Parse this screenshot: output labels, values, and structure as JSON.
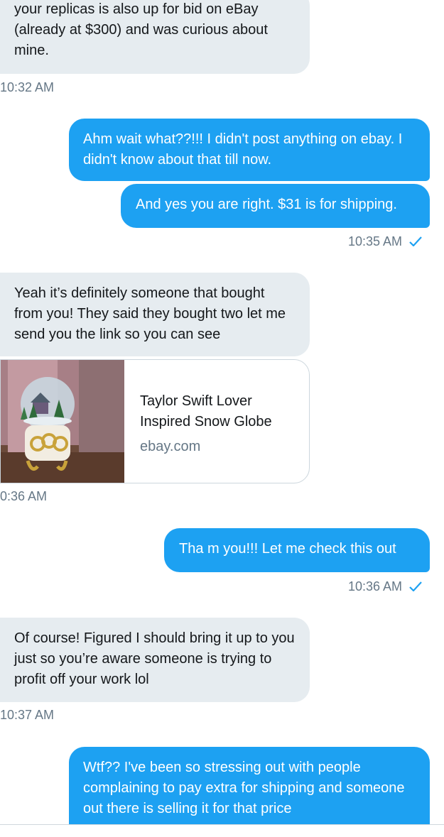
{
  "messages": [
    {
      "dir": "in",
      "text": "your replicas is also up for bid on eBay (already at $300) and was curious about mine."
    },
    {
      "dir": "time_in",
      "text": "10:32 AM"
    },
    {
      "dir": "out",
      "text": "Ahm wait what??!!! I didn't post anything on ebay. I didn't know about that till now."
    },
    {
      "dir": "out",
      "text": "And yes you are right. $31 is for shipping."
    },
    {
      "dir": "time_out",
      "text": "10:35 AM"
    },
    {
      "dir": "in",
      "text": "Yeah it’s definitely someone that bought from you! They said they bought two let me send you the link so you can see"
    },
    {
      "dir": "card",
      "title": "Taylor Swift Lover Inspired Snow Globe",
      "domain": "ebay.com"
    },
    {
      "dir": "time_in",
      "text": "0:36 AM"
    },
    {
      "dir": "out",
      "text": "Tha m you!!! Let me check this out"
    },
    {
      "dir": "time_out",
      "text": "10:36 AM"
    },
    {
      "dir": "in",
      "text": "Of course! Figured I should bring it up to you just so you’re aware someone is trying to profit off your work lol"
    },
    {
      "dir": "time_in",
      "text": "10:37 AM"
    },
    {
      "dir": "out",
      "text": "Wtf?? I've been so stressing out with people complaining to pay extra for shipping and someone out there is selling it for that price"
    }
  ],
  "colors": {
    "outgoing": "#1da1f2",
    "incoming": "#e6ecf0",
    "timestamp": "#657786",
    "check": "#1da1f2"
  },
  "icons": {
    "read_receipt": "checkmark-icon"
  }
}
